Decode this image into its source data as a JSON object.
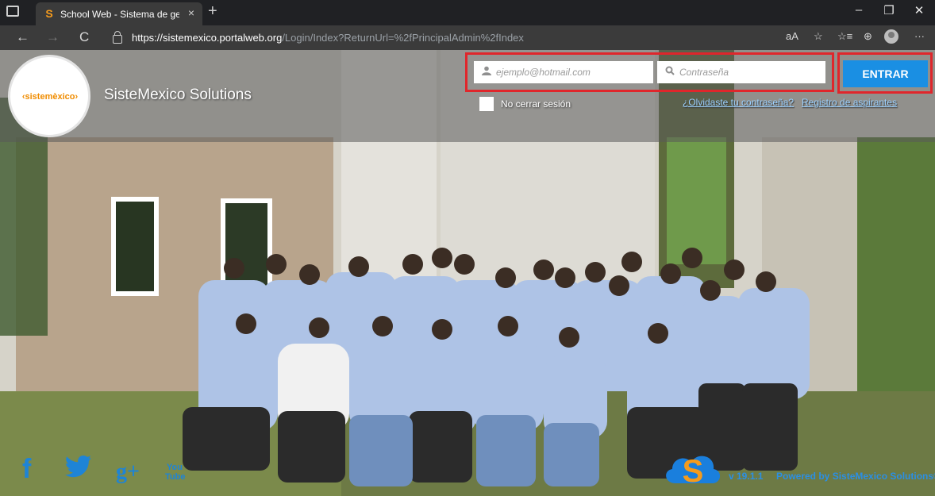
{
  "browser": {
    "tab_title": "School Web - Sistema de gestio",
    "tab_favicon": "S",
    "tab_close": "×",
    "new_tab": "+",
    "url_host": "https://sistemexico.portalweb.org",
    "url_path": "/Login/Index?ReturnUrl=%2fPrincipalAdmin%2fIndex",
    "minimize": "–",
    "restore": "❐",
    "close": "✕",
    "back": "←",
    "forward": "→",
    "reload": "C",
    "read_aloud": "aA",
    "favorites_add": "☆",
    "favorites": "☆≡",
    "collections": "⊕",
    "more": "···"
  },
  "header": {
    "logo_text": "‹sistemèxico›",
    "site_name": "SisteMexico Solutions"
  },
  "login": {
    "email_placeholder": "ejemplo@hotmail.com",
    "email_icon": "user-icon",
    "password_placeholder": "Contraseña",
    "password_icon": "search-icon",
    "submit_label": "ENTRAR",
    "remember_label": "No cerrar sesión",
    "forgot_label": "¿Olvidaste tu contraseña?",
    "register_label": "Registro de aspirantes"
  },
  "footer": {
    "social": [
      {
        "name": "facebook",
        "glyph": "f"
      },
      {
        "name": "twitter",
        "glyph": "🐦"
      },
      {
        "name": "googleplus",
        "glyph": "g+"
      },
      {
        "name": "youtube",
        "glyph": "You Tube"
      }
    ],
    "version": "v 19.1.1",
    "powered_by": "Powered by SisteMexico Solutions®"
  },
  "colors": {
    "accent": "#1a8fe3",
    "highlight_box": "#e0262b",
    "logo_orange": "#f08c00"
  }
}
